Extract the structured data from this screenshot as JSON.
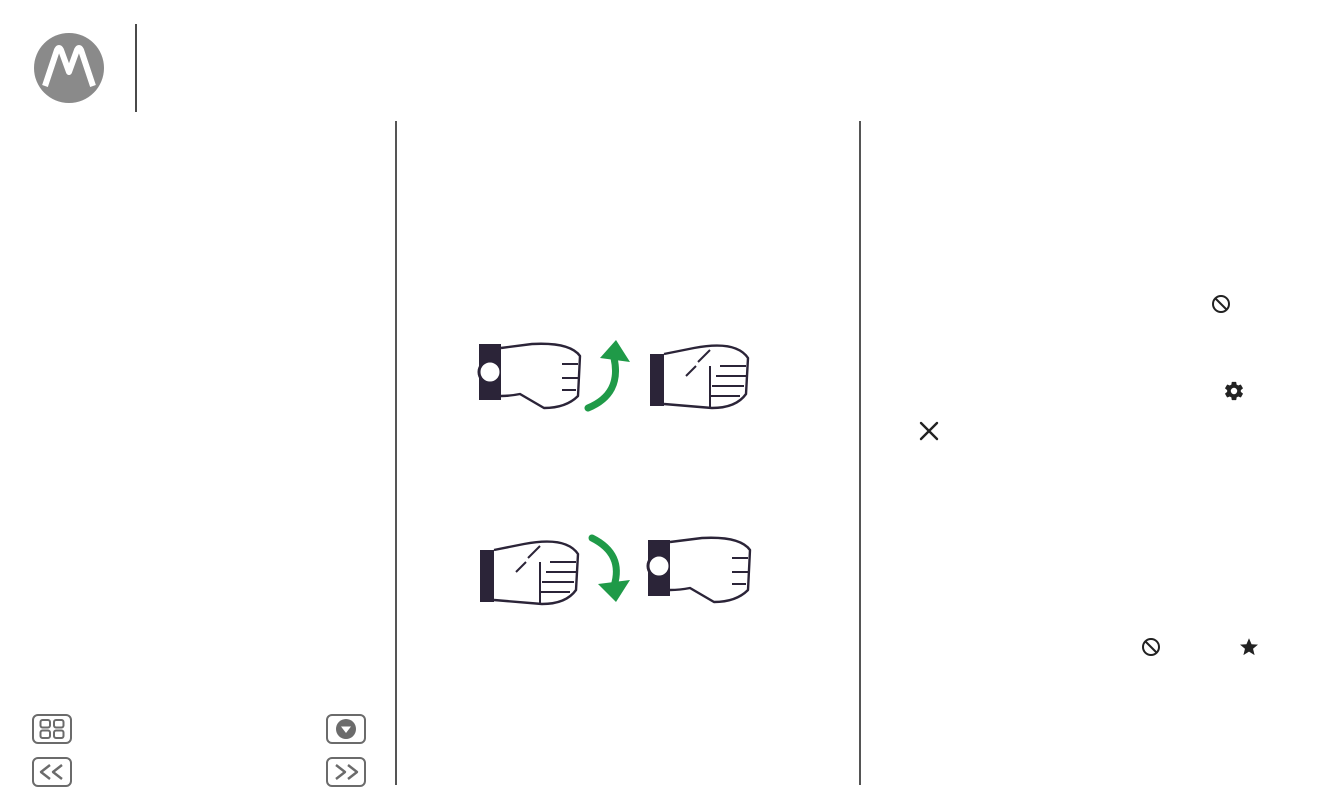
{
  "logo": {
    "icon": "motorola-logo-icon",
    "color": "#8a8a8a"
  },
  "nav": {
    "menu_icon": "grid-menu-icon",
    "more_icon": "dropdown-icon",
    "back_icon": "back-arrow-icon",
    "next_icon": "next-arrow-icon"
  },
  "illustrations": [
    {
      "name": "wrist-twist-up",
      "arrow_color": "#1f9a48",
      "arrow_direction": "up"
    },
    {
      "name": "wrist-twist-down",
      "arrow_color": "#1f9a48",
      "arrow_direction": "down"
    }
  ],
  "right_column": {
    "icons": [
      "block-icon",
      "settings-gear-icon",
      "close-icon",
      "block-icon",
      "star-icon"
    ]
  }
}
